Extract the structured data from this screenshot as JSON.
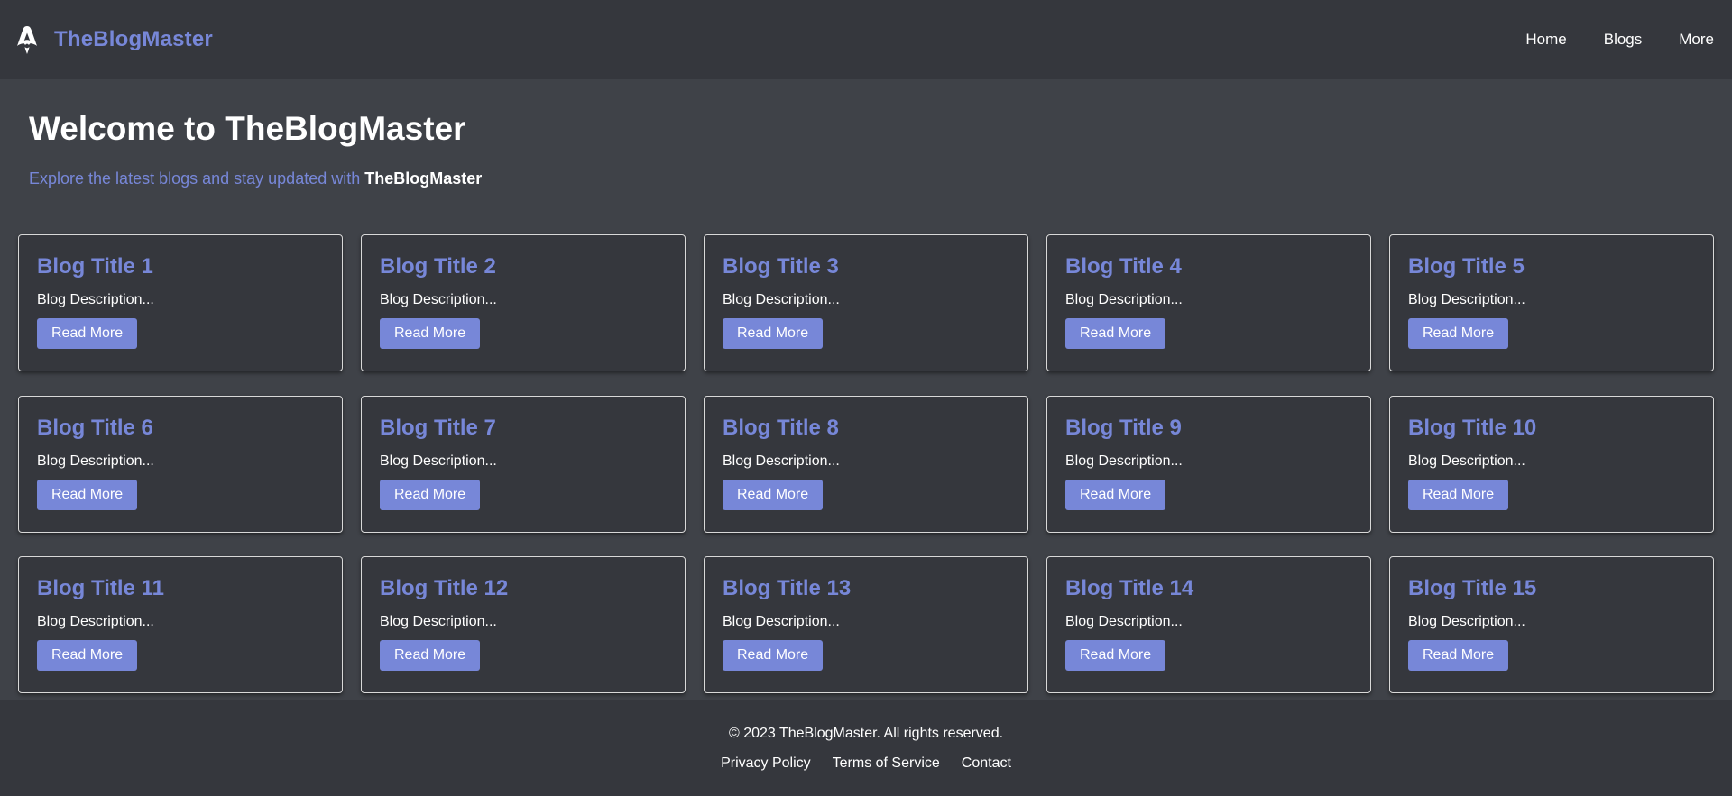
{
  "header": {
    "logo_icon": "rocket-logo-icon",
    "brand": "TheBlogMaster",
    "nav": [
      {
        "label": "Home"
      },
      {
        "label": "Blogs"
      },
      {
        "label": "More"
      }
    ]
  },
  "hero": {
    "title": "Welcome to TheBlogMaster",
    "subtitle_text": "Explore the latest blogs and stay updated with",
    "subtitle_brand": "TheBlogMaster"
  },
  "blogs": [
    {
      "title": "Blog Title 1",
      "description": "Blog Description...",
      "button": "Read More"
    },
    {
      "title": "Blog Title 2",
      "description": "Blog Description...",
      "button": "Read More"
    },
    {
      "title": "Blog Title 3",
      "description": "Blog Description...",
      "button": "Read More"
    },
    {
      "title": "Blog Title 4",
      "description": "Blog Description...",
      "button": "Read More"
    },
    {
      "title": "Blog Title 5",
      "description": "Blog Description...",
      "button": "Read More"
    },
    {
      "title": "Blog Title 6",
      "description": "Blog Description...",
      "button": "Read More"
    },
    {
      "title": "Blog Title 7",
      "description": "Blog Description...",
      "button": "Read More"
    },
    {
      "title": "Blog Title 8",
      "description": "Blog Description...",
      "button": "Read More"
    },
    {
      "title": "Blog Title 9",
      "description": "Blog Description...",
      "button": "Read More"
    },
    {
      "title": "Blog Title 10",
      "description": "Blog Description...",
      "button": "Read More"
    },
    {
      "title": "Blog Title 11",
      "description": "Blog Description...",
      "button": "Read More"
    },
    {
      "title": "Blog Title 12",
      "description": "Blog Description...",
      "button": "Read More"
    },
    {
      "title": "Blog Title 13",
      "description": "Blog Description...",
      "button": "Read More"
    },
    {
      "title": "Blog Title 14",
      "description": "Blog Description...",
      "button": "Read More"
    },
    {
      "title": "Blog Title 15",
      "description": "Blog Description...",
      "button": "Read More"
    }
  ],
  "footer": {
    "copyright": "© 2023 TheBlogMaster. All rights reserved.",
    "links": [
      {
        "label": "Privacy Policy"
      },
      {
        "label": "Terms of Service"
      },
      {
        "label": "Contact"
      }
    ]
  },
  "colors": {
    "accent": "#7787d8",
    "header_bg": "#35373d",
    "page_bg": "#3f4248",
    "card_bg": "#35373d",
    "text": "#ffffff"
  }
}
